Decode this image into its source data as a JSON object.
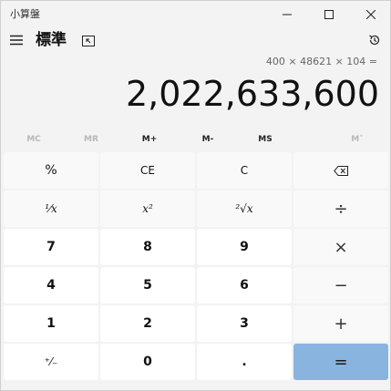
{
  "window": {
    "title": "小算盤"
  },
  "header": {
    "mode": "標準"
  },
  "display": {
    "expression": "400 × 48621 × 104 =",
    "result": "2,022,633,600"
  },
  "memory": [
    {
      "label": "MC",
      "enabled": false
    },
    {
      "label": "MR",
      "enabled": false
    },
    {
      "label": "M+",
      "enabled": true
    },
    {
      "label": "M-",
      "enabled": true
    },
    {
      "label": "MS",
      "enabled": true
    },
    {
      "label": "M˅",
      "enabled": false
    }
  ],
  "keys": {
    "percent": "%",
    "ce": "CE",
    "c": "C",
    "backspace": "backspace-icon",
    "reciprocal": "¹⁄x",
    "square": "x²",
    "sqrt": "²√x",
    "divide": "÷",
    "seven": "7",
    "eight": "8",
    "nine": "9",
    "multiply": "×",
    "four": "4",
    "five": "5",
    "six": "6",
    "minus": "−",
    "one": "1",
    "two": "2",
    "three": "3",
    "plus": "+",
    "negate": "⁺⁄₋",
    "zero": "0",
    "decimal": ".",
    "equals": "="
  },
  "colors": {
    "equals_bg": "#8ab4e0",
    "window_bg": "#f3f3f3"
  }
}
